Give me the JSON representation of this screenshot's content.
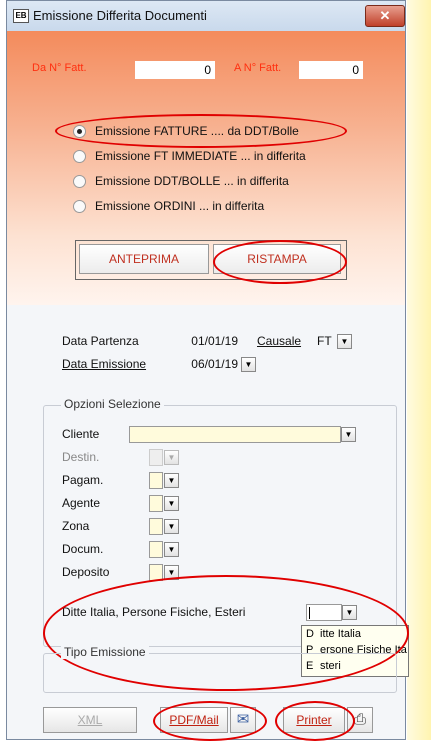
{
  "window": {
    "title": "Emissione Differita Documenti",
    "close_glyph": "✕",
    "app_icon_glyph": "EB"
  },
  "range": {
    "from_label": "Da N° Fatt.",
    "from_value": "0",
    "to_label": "A N° Fatt.",
    "to_value": "0"
  },
  "options": [
    {
      "label": "Emissione FATTURE .... da DDT/Bolle",
      "selected": true
    },
    {
      "label": "Emissione FT IMMEDIATE ... in differita",
      "selected": false
    },
    {
      "label": "Emissione DDT/BOLLE ... in differita",
      "selected": false
    },
    {
      "label": "Emissione ORDINI ... in differita",
      "selected": false
    }
  ],
  "mode_buttons": {
    "preview": "ANTEPRIMA",
    "reprint": "RISTAMPA"
  },
  "dates": {
    "departure_label": "Data Partenza",
    "departure_value": "01/01/19",
    "causal_label": "Causale",
    "causal_value": "FT",
    "issue_label": "Data Emissione",
    "issue_value": "06/01/19"
  },
  "selection": {
    "title": "Opzioni Selezione",
    "fields": [
      "Cliente",
      "Destin.",
      "Pagam.",
      "Agente",
      "Zona",
      "Docum.",
      "Deposito"
    ],
    "type_label": "Ditte Italia, Persone Fisiche, Esteri",
    "dropdown_options": [
      {
        "code": "D",
        "text": "itte Italia"
      },
      {
        "code": "P",
        "text": "ersone Fisiche Ita"
      },
      {
        "code": "E",
        "text": "steri"
      }
    ]
  },
  "issue_type": {
    "title": "Tipo Emissione"
  },
  "bottom": {
    "xml": "XML",
    "pdf_mail": "PDF/Mail",
    "printer": "Printer"
  },
  "icons": {
    "dropdown_arrow": "▼",
    "envelope": "✉",
    "printer": "⎙"
  },
  "colors": {
    "accent_red": "#e00000",
    "panel_orange": "#f48b5c",
    "label_red": "#ff3010",
    "field_yellow": "#fffbdc"
  }
}
